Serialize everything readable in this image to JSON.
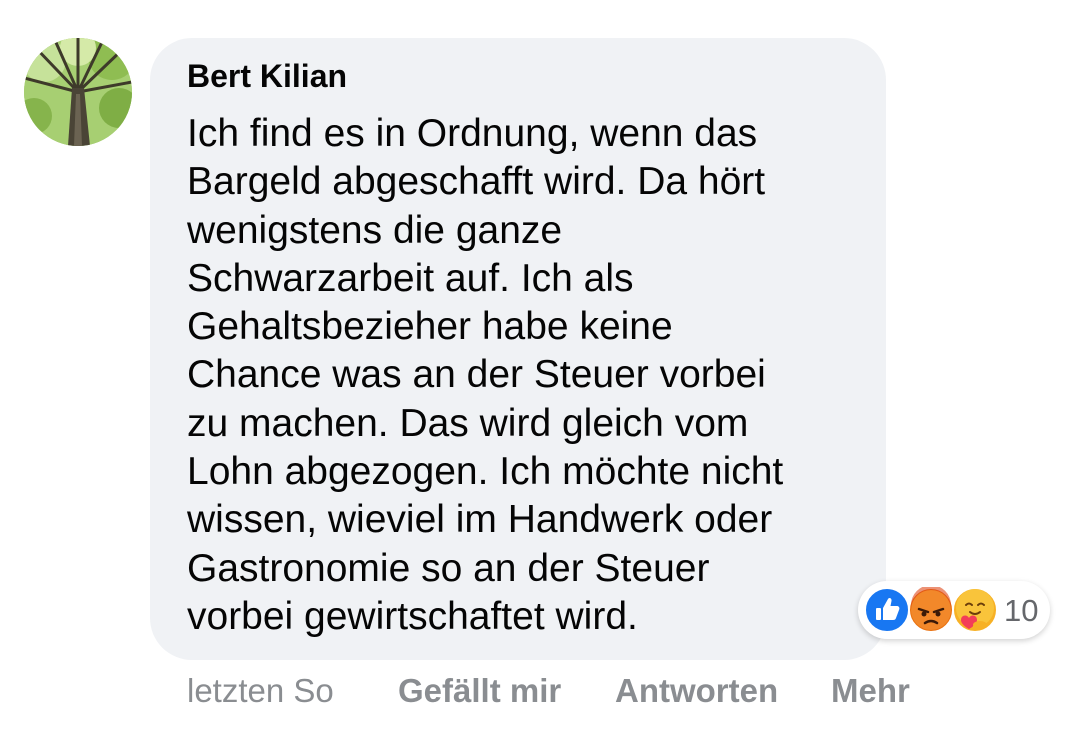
{
  "comment": {
    "author": "Bert Kilian",
    "lines": [
      "Ich find es in Ordnung, wenn das",
      "Bargeld abgeschafft wird. Da hört",
      "wenigstens die ganze",
      "Schwarzarbeit auf. Ich als",
      "Gehaltsbezieher habe keine",
      "Chance was an der Steuer vorbei",
      "zu machen. Das wird gleich vom",
      "Lohn abgezogen. Ich möchte nicht",
      "wissen, wieviel im Handwerk oder",
      "Gastronomie so an der Steuer",
      "vorbei gewirtschaftet wird."
    ]
  },
  "reactions": {
    "icons": [
      "like-icon",
      "angry-icon",
      "care-icon"
    ],
    "count": "10"
  },
  "actions": {
    "timestamp": "letzten So",
    "like_label": "Gefällt mir",
    "reply_label": "Antworten",
    "more_label": "Mehr"
  },
  "colors": {
    "bubble": "#f0f2f5",
    "like_blue": "#1877f2",
    "angry_orange": "#e9710f",
    "care_yellow": "#f7b125",
    "action_text": "#8a8d91"
  }
}
